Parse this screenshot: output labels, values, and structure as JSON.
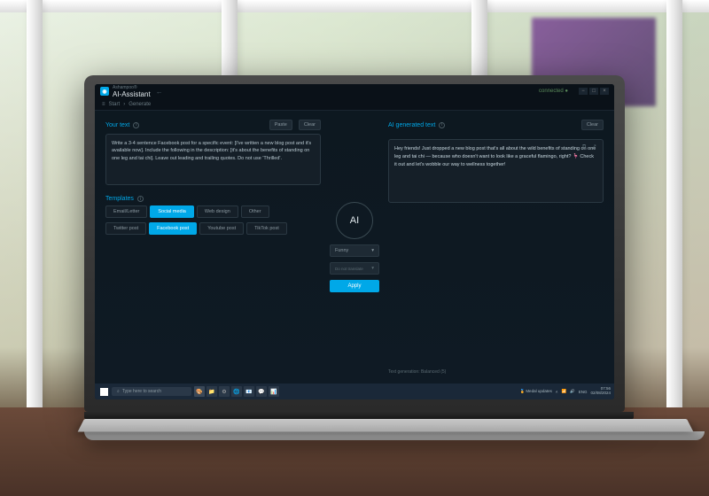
{
  "app": {
    "vendor": "Ashampoo®",
    "title": "AI-Assistant",
    "connected": "connected"
  },
  "breadcrumb": {
    "menu": "≡",
    "start": "Start",
    "sep": "›",
    "current": "Generate"
  },
  "input": {
    "title": "Your text",
    "paste": "Paste",
    "clear": "Clear",
    "value": "Write a 3-4 sentence Facebook post for a specific event: [I've written a new blog post and it's available now]. Include the following in the description: [it's about the benefits of standing on one leg and tai chi]. Leave out leading and trailing quotes. Do not use 'Thrilled'."
  },
  "templates": {
    "title": "Templates",
    "categories": [
      "Email/Letter",
      "Social media",
      "Web design",
      "Other"
    ],
    "active_category": 1,
    "items": [
      "Twitter post",
      "Facebook post",
      "Youtube post",
      "TikTok post"
    ],
    "active_item": 1
  },
  "center": {
    "ai_label": "AI",
    "tone": "Funny",
    "translate": "Do not translate",
    "apply": "Apply"
  },
  "output": {
    "title": "AI generated text",
    "clear": "Clear",
    "value": "Hey friends! Just dropped a new blog post that's all about the wild benefits of standing on one leg and tai chi — because who doesn't want to look like a graceful flamingo, right? 🦩 Check it out and let's wobble our way to wellness together!"
  },
  "status": "Text generation: Balanced (5)",
  "taskbar": {
    "search": "Type here to search",
    "medal": "Medal updates",
    "lang": "ENG",
    "time": "07:56",
    "date": "02/08/2024"
  }
}
